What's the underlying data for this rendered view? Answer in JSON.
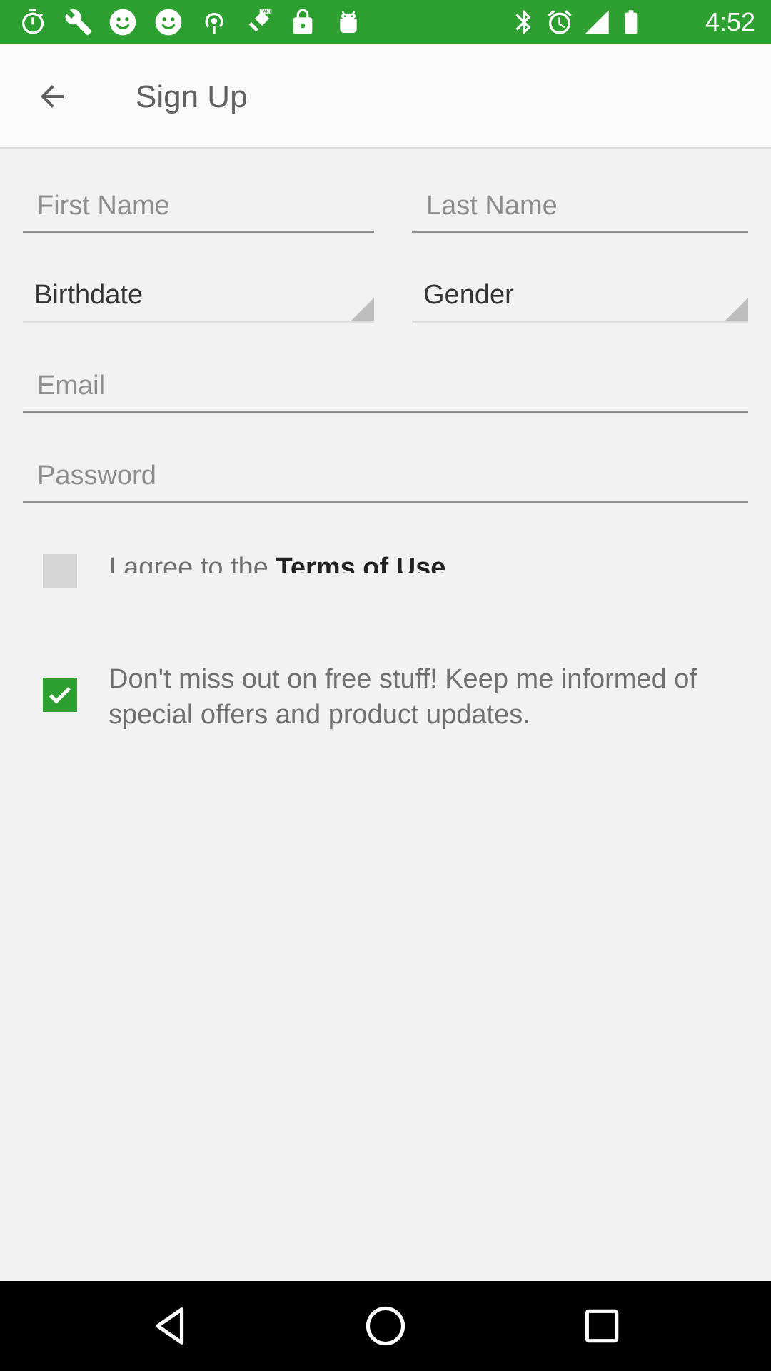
{
  "status_bar": {
    "time": "4:52",
    "left_icons": [
      "stopwatch-icon",
      "wrench-icon",
      "smiley-icon",
      "smiley-icon",
      "podcast-icon",
      "fake-gps-icon",
      "lock-icon",
      "android-icon"
    ],
    "right_icons": [
      "bluetooth-icon",
      "alarm-icon",
      "signal-icon",
      "battery-icon"
    ],
    "color": "#2ea032"
  },
  "app_bar": {
    "title": "Sign Up",
    "back_icon": "back-arrow-icon"
  },
  "form": {
    "first_name": {
      "placeholder": "First Name",
      "value": ""
    },
    "last_name": {
      "placeholder": "Last Name",
      "value": ""
    },
    "birthdate": {
      "label": "Birthdate"
    },
    "gender": {
      "label": "Gender"
    },
    "email": {
      "placeholder": "Email",
      "value": ""
    },
    "password": {
      "placeholder": "Password",
      "value": ""
    }
  },
  "terms": {
    "checked": false,
    "text_prefix": "I agree to the ",
    "link_text": "Terms of Use"
  },
  "newsletter": {
    "checked": true,
    "text": "Don't miss out on free stuff! Keep me informed of special offers and product updates."
  },
  "nav_bar": {
    "buttons": [
      "back-triangle-icon",
      "home-circle-icon",
      "recents-square-icon"
    ]
  }
}
